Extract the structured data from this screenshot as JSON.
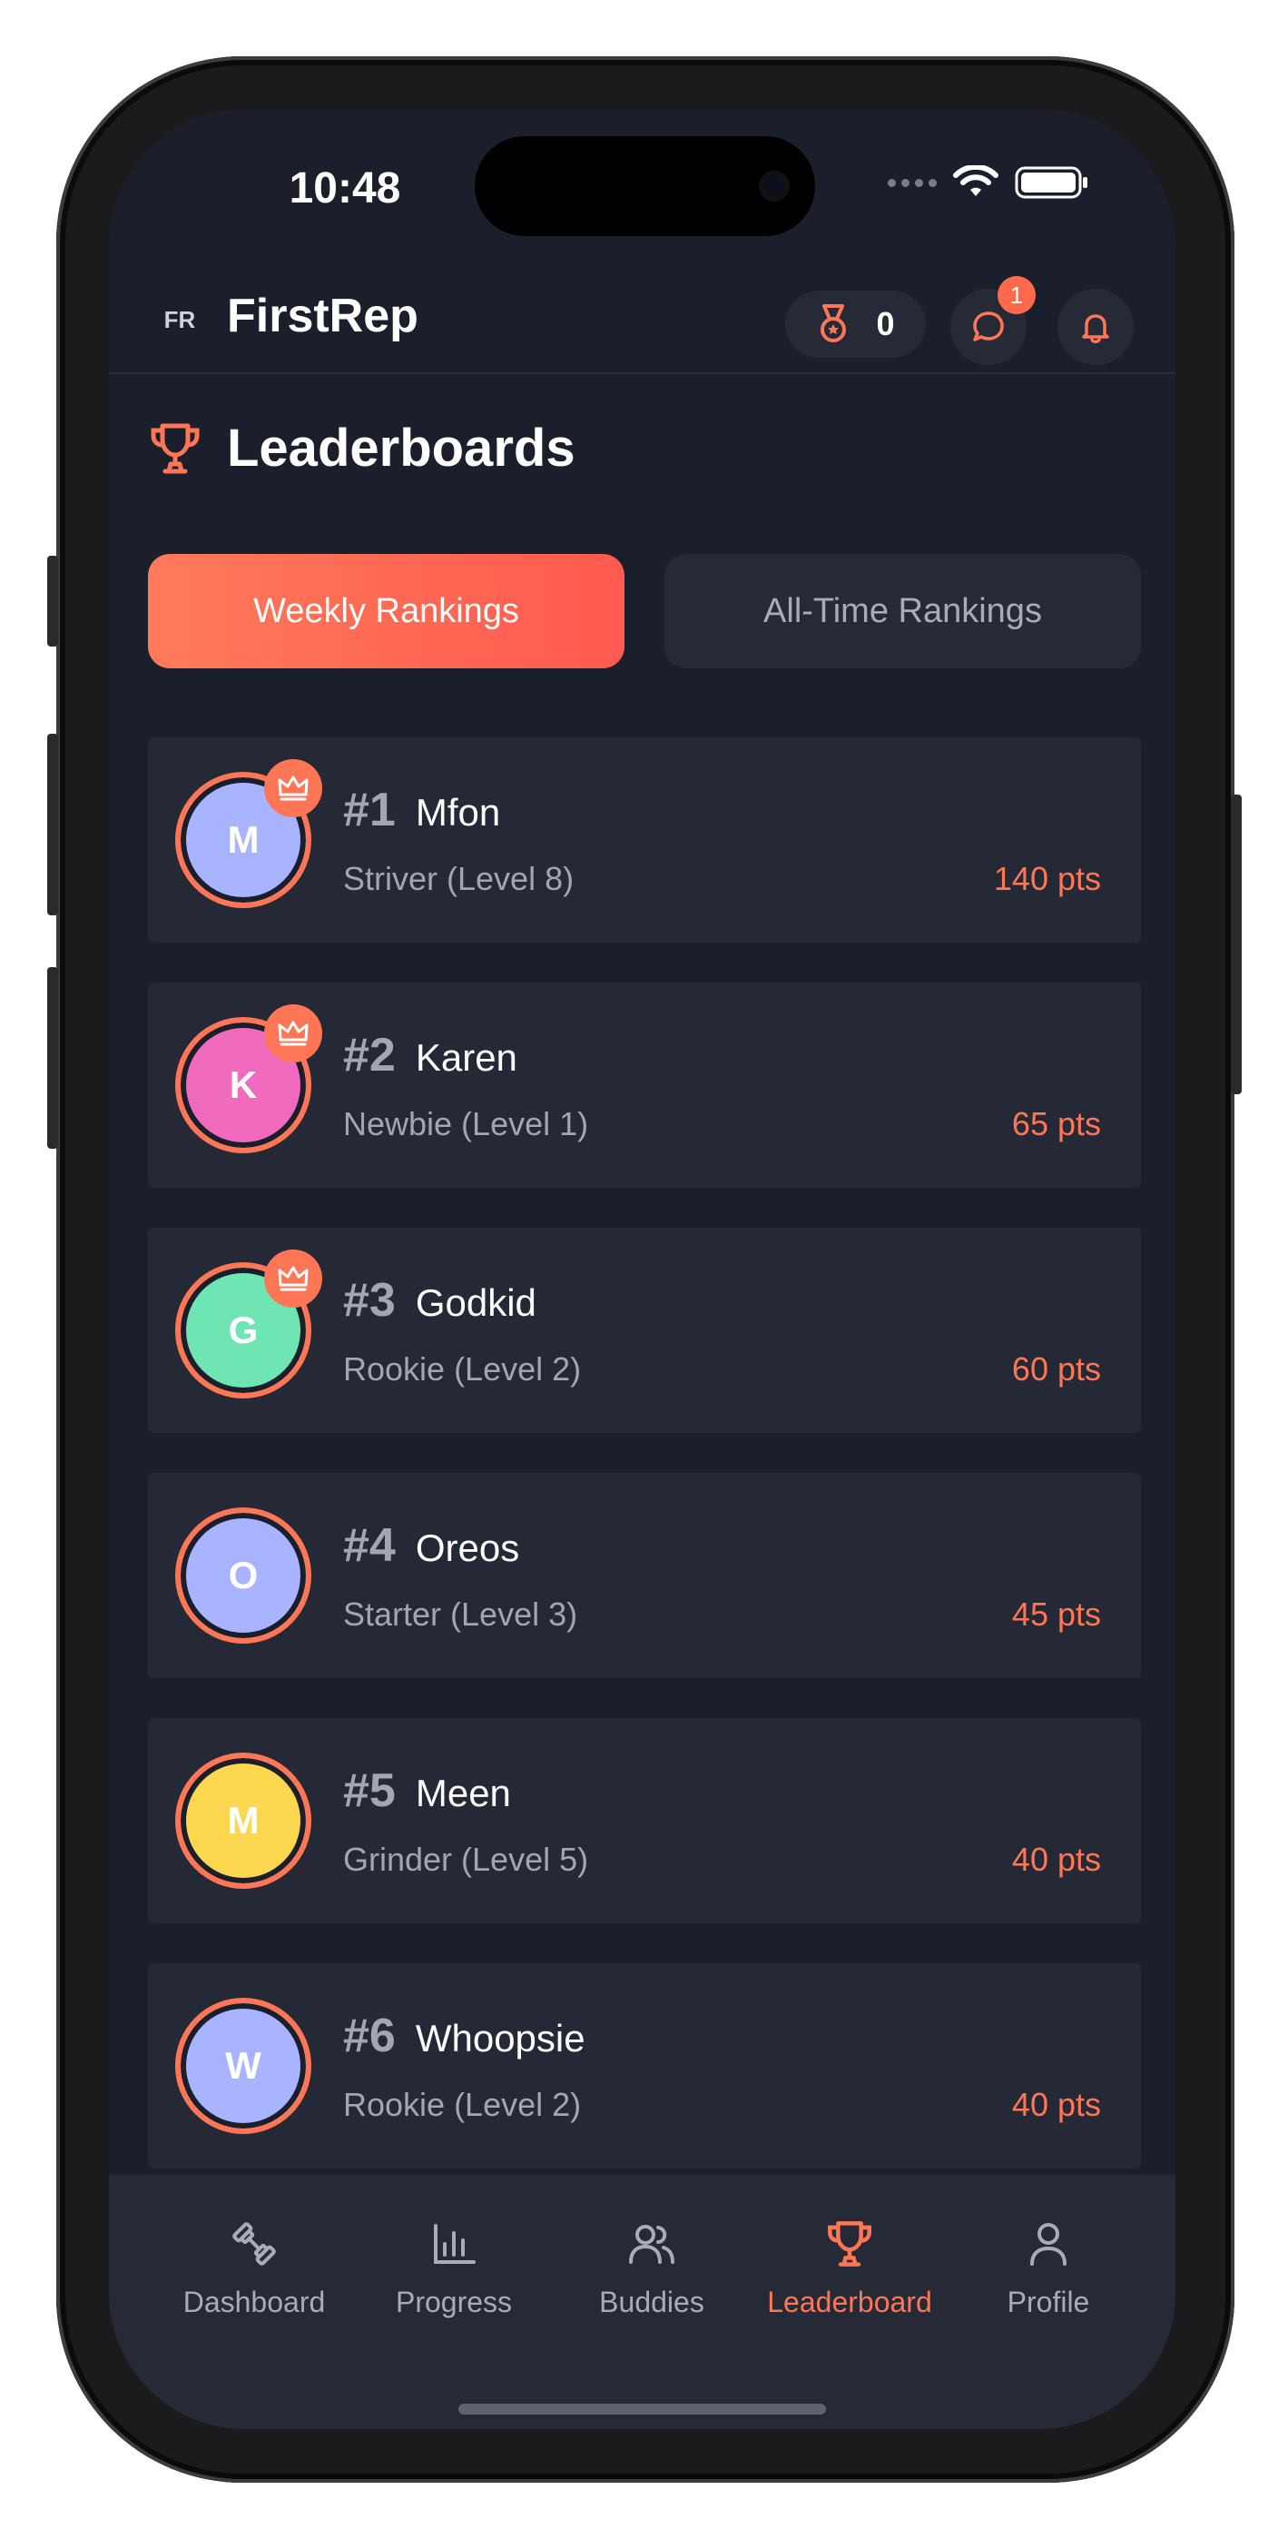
{
  "status_bar": {
    "time": "10:48"
  },
  "header": {
    "logo_text": "FR",
    "app_title": "FirstRep",
    "points_value": "0",
    "messages_badge": "1"
  },
  "page": {
    "title": "Leaderboards",
    "tabs": [
      {
        "label": "Weekly Rankings",
        "active": true
      },
      {
        "label": "All-Time Rankings",
        "active": false
      }
    ]
  },
  "leaderboard": [
    {
      "initial": "M",
      "rank": "#1",
      "name": "Mfon",
      "level": "Striver (Level 8)",
      "points": "140 pts",
      "avatar_color": "#a8b4ff",
      "crown": true
    },
    {
      "initial": "K",
      "rank": "#2",
      "name": "Karen",
      "level": "Newbie (Level 1)",
      "points": "65 pts",
      "avatar_color": "#f06bbd",
      "crown": true
    },
    {
      "initial": "G",
      "rank": "#3",
      "name": "Godkid",
      "level": "Rookie (Level 2)",
      "points": "60 pts",
      "avatar_color": "#6fe5b3",
      "crown": true
    },
    {
      "initial": "O",
      "rank": "#4",
      "name": "Oreos",
      "level": "Starter (Level 3)",
      "points": "45 pts",
      "avatar_color": "#a8b4ff",
      "crown": false
    },
    {
      "initial": "M",
      "rank": "#5",
      "name": "Meen",
      "level": "Grinder (Level 5)",
      "points": "40 pts",
      "avatar_color": "#fdd74f",
      "crown": false
    },
    {
      "initial": "W",
      "rank": "#6",
      "name": "Whoopsie",
      "level": "Rookie (Level 2)",
      "points": "40 pts",
      "avatar_color": "#a8b4ff",
      "crown": false
    }
  ],
  "bottom_nav": [
    {
      "label": "Dashboard",
      "icon": "dumbbell-icon",
      "active": false
    },
    {
      "label": "Progress",
      "icon": "bar-chart-icon",
      "active": false
    },
    {
      "label": "Buddies",
      "icon": "users-icon",
      "active": false
    },
    {
      "label": "Leaderboard",
      "icon": "trophy-icon",
      "active": true
    },
    {
      "label": "Profile",
      "icon": "user-icon",
      "active": false
    }
  ],
  "colors": {
    "accent": "#ff7656",
    "background": "#1b1f2b",
    "card": "#252935"
  }
}
